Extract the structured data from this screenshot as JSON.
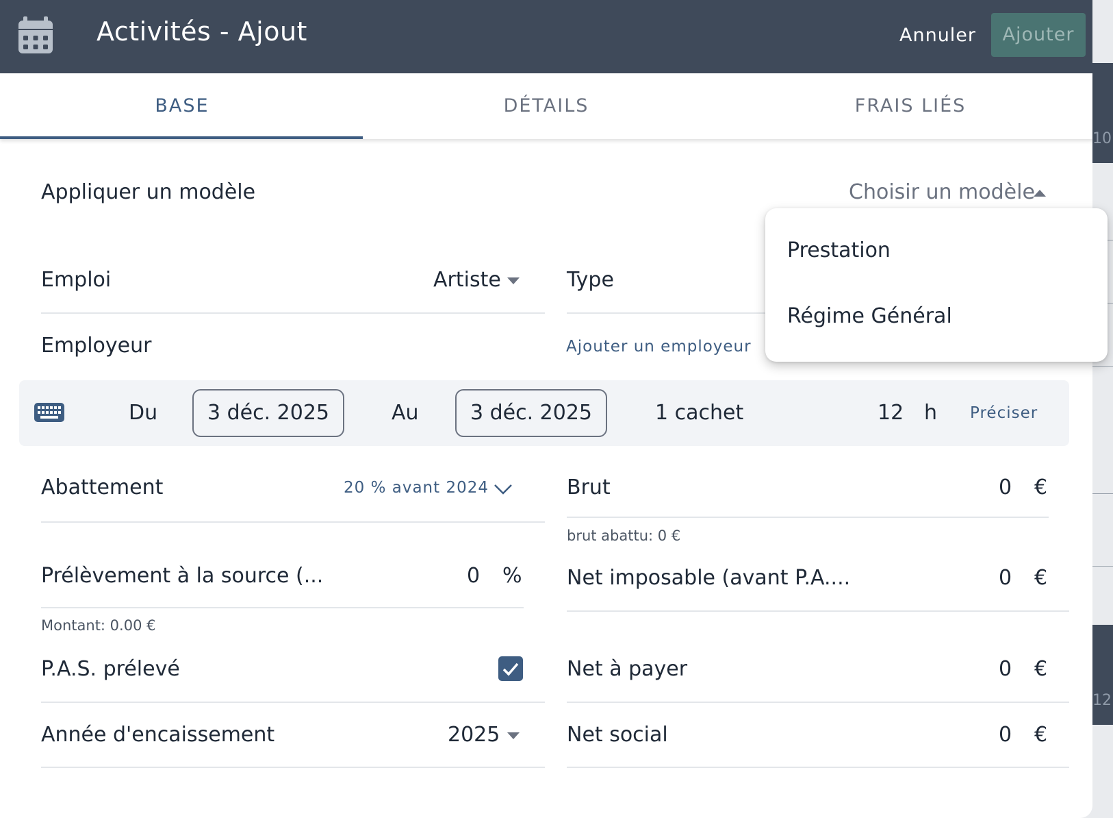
{
  "header": {
    "title": "Activités - Ajout",
    "cancel_label": "Annuler",
    "add_label": "Ajouter",
    "icon": "calendar-icon"
  },
  "tabs": [
    {
      "label": "BASE",
      "active": true
    },
    {
      "label": "DÉTAILS",
      "active": false
    },
    {
      "label": "FRAIS LIÉS",
      "active": false
    }
  ],
  "template": {
    "label": "Appliquer un modèle",
    "select_placeholder": "Choisir un modèle",
    "options": [
      "Prestation",
      "Régime Général"
    ]
  },
  "emploi": {
    "label": "Emploi",
    "value": "Artiste"
  },
  "type": {
    "label": "Type"
  },
  "employeur": {
    "label": "Employeur",
    "add_link": "Ajouter un employeur"
  },
  "dates": {
    "from_label": "Du",
    "from_value": "3 déc. 2025",
    "to_label": "Au",
    "to_value": "3 déc. 2025",
    "cachet": "1 cachet",
    "hours_value": "12",
    "hours_unit": "h",
    "precise_link": "Préciser",
    "icon": "keyboard-icon"
  },
  "left_fields": {
    "abattement": {
      "label": "Abattement",
      "value": "20 % avant 2024"
    },
    "prelevement": {
      "label": "Prélèvement à la source (...",
      "value": "0",
      "unit": "%",
      "hint": "Montant: 0.00 €"
    },
    "pas_preleve": {
      "label": "P.A.S. prélevé",
      "checked": true
    },
    "annee": {
      "label": "Année d'encaissement",
      "value": "2025"
    }
  },
  "right_fields": {
    "brut": {
      "label": "Brut",
      "value": "0",
      "unit": "€",
      "hint": "brut abattu: 0 €"
    },
    "net_imposable": {
      "label": "Net imposable (avant P.A....",
      "value": "0",
      "unit": "€"
    },
    "net_payer": {
      "label": "Net à payer",
      "value": "0",
      "unit": "€"
    },
    "net_social": {
      "label": "Net social",
      "value": "0",
      "unit": "€"
    }
  },
  "background": {
    "num1": "10",
    "num2": "12"
  },
  "colors": {
    "header_bg": "#3f4a5a",
    "accent": "#3e5d82",
    "add_button_bg": "#4a7472"
  }
}
